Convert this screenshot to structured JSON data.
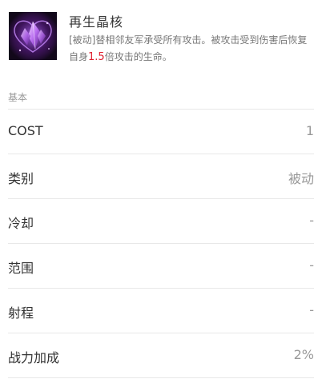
{
  "skill": {
    "icon": "crystal-heart-icon",
    "name": "再生晶核",
    "desc_prefix": "[被动]替相邻友军承受所有攻击。被攻击受到伤害后恢复自身",
    "desc_number": "1.5",
    "desc_suffix": "倍攻击的生命。",
    "highlight_color": "#e0202f"
  },
  "section": {
    "title": "基本"
  },
  "stats": [
    {
      "label": "COST",
      "value": "1"
    },
    {
      "label": "类别",
      "value": "被动"
    },
    {
      "label": "冷却",
      "value": "-"
    },
    {
      "label": "范围",
      "value": "-"
    },
    {
      "label": "射程",
      "value": "-"
    },
    {
      "label": "战力加成",
      "value": "2%"
    }
  ]
}
